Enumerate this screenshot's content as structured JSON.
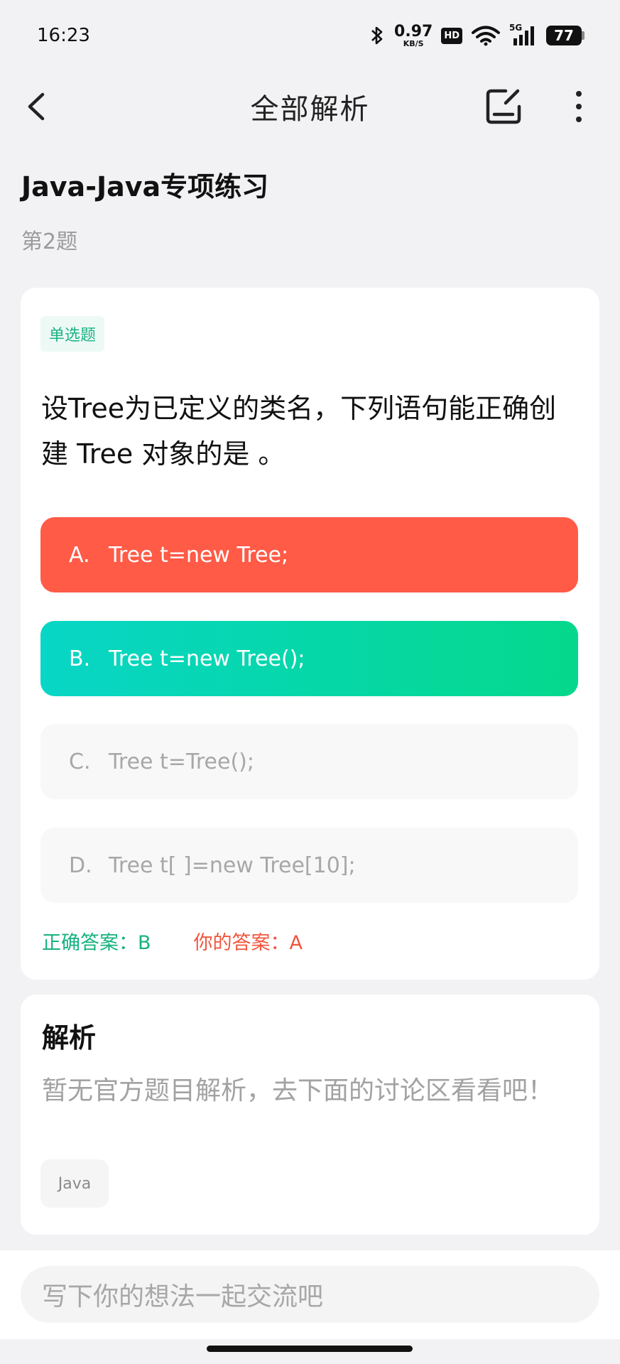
{
  "status_bar": {
    "time": "16:23",
    "net_speed_value": "0.97",
    "net_speed_unit": "KB/S",
    "hd_label": "HD",
    "signal_label": "5G",
    "battery": "77",
    "icons": [
      "bluetooth-icon",
      "wifi-icon",
      "signal-icon",
      "battery-icon"
    ]
  },
  "nav": {
    "title": "全部解析",
    "icons": [
      "back-icon",
      "edit-note-icon",
      "more-vertical-icon"
    ]
  },
  "page": {
    "title": "Java-Java专项练习",
    "subtitle": "第2题"
  },
  "question": {
    "type": "单选题",
    "text": "设Tree为已定义的类名，下列语句能正确创建 Tree 对象的是 。",
    "options": [
      {
        "letter": "A.",
        "text": "Tree t=new Tree;",
        "state": "wrong"
      },
      {
        "letter": "B.",
        "text": "Tree t=new Tree();",
        "state": "correct"
      },
      {
        "letter": "C.",
        "text": "Tree t=Tree();",
        "state": "normal"
      },
      {
        "letter": "D.",
        "text": "Tree t[ ]=new Tree[10];",
        "state": "normal"
      }
    ],
    "correct_answer": "正确答案：B",
    "your_answer": "你的答案：A"
  },
  "explanation": {
    "title": "解析",
    "text": "暂无官方题目解析，去下面的讨论区看看吧！",
    "tag": "Java"
  },
  "comment": {
    "placeholder": "写下你的想法一起交流吧"
  },
  "colors": {
    "wrong": "#ff5b47",
    "correct_start": "#08d6c6",
    "correct_end": "#05d88c",
    "tag_green": "#1bb386"
  }
}
